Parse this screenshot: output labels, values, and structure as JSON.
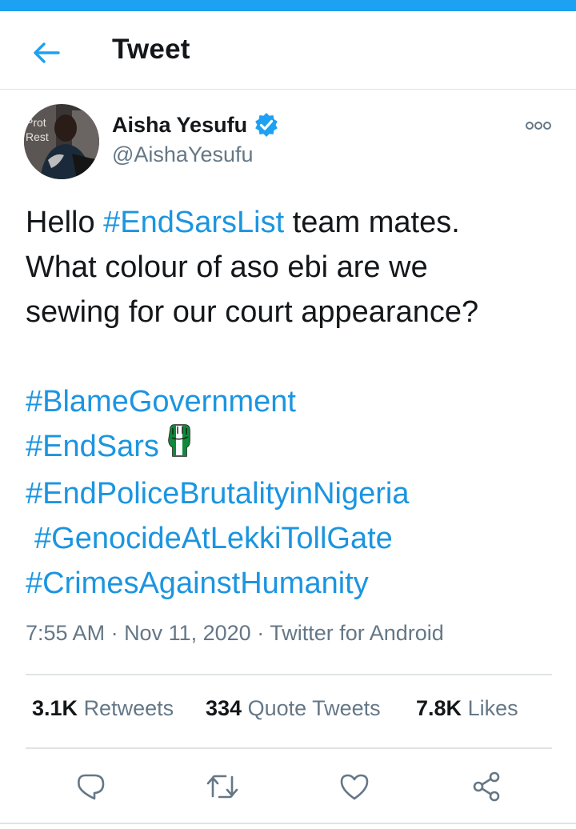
{
  "header": {
    "title": "Tweet",
    "back_icon": "back-arrow-icon"
  },
  "author": {
    "name": "Aisha Yesufu",
    "handle": "@AishaYesufu",
    "verified_icon": "verified-badge-icon",
    "avatar_text_1": "Prot",
    "avatar_text_2": "Rest"
  },
  "tweet": {
    "line1_pre": "Hello ",
    "line1_hashtag": "#EndSarsList",
    "line1_post": " team mates.",
    "line2": "What colour of aso ebi are we",
    "line3": "sewing for our court appearance?",
    "hashtags": [
      "#BlameGovernment",
      "#EndSars",
      "#EndPoliceBrutalityinNigeria",
      "#GenocideAtLekkiTollGate",
      "#CrimesAgainstHumanity"
    ],
    "emoji": "raised-fist-nigeria-flag-emoji"
  },
  "meta": {
    "time": "7:55 AM",
    "dot": " · ",
    "date": "Nov 11, 2020",
    "source": "Twitter for Android"
  },
  "stats": {
    "retweets_count": "3.1K",
    "retweets_label": "Retweets",
    "quotes_count": "334",
    "quotes_label": "Quote Tweets",
    "likes_count": "7.8K",
    "likes_label": "Likes"
  },
  "actions": {
    "reply_icon": "reply-icon",
    "retweet_icon": "retweet-icon",
    "like_icon": "heart-icon",
    "share_icon": "share-icon",
    "more_icon": "more-options-icon"
  },
  "colors": {
    "accent": "#1da1f2",
    "hashtag": "#1b95e0",
    "muted": "#657786",
    "text": "#14171a"
  }
}
